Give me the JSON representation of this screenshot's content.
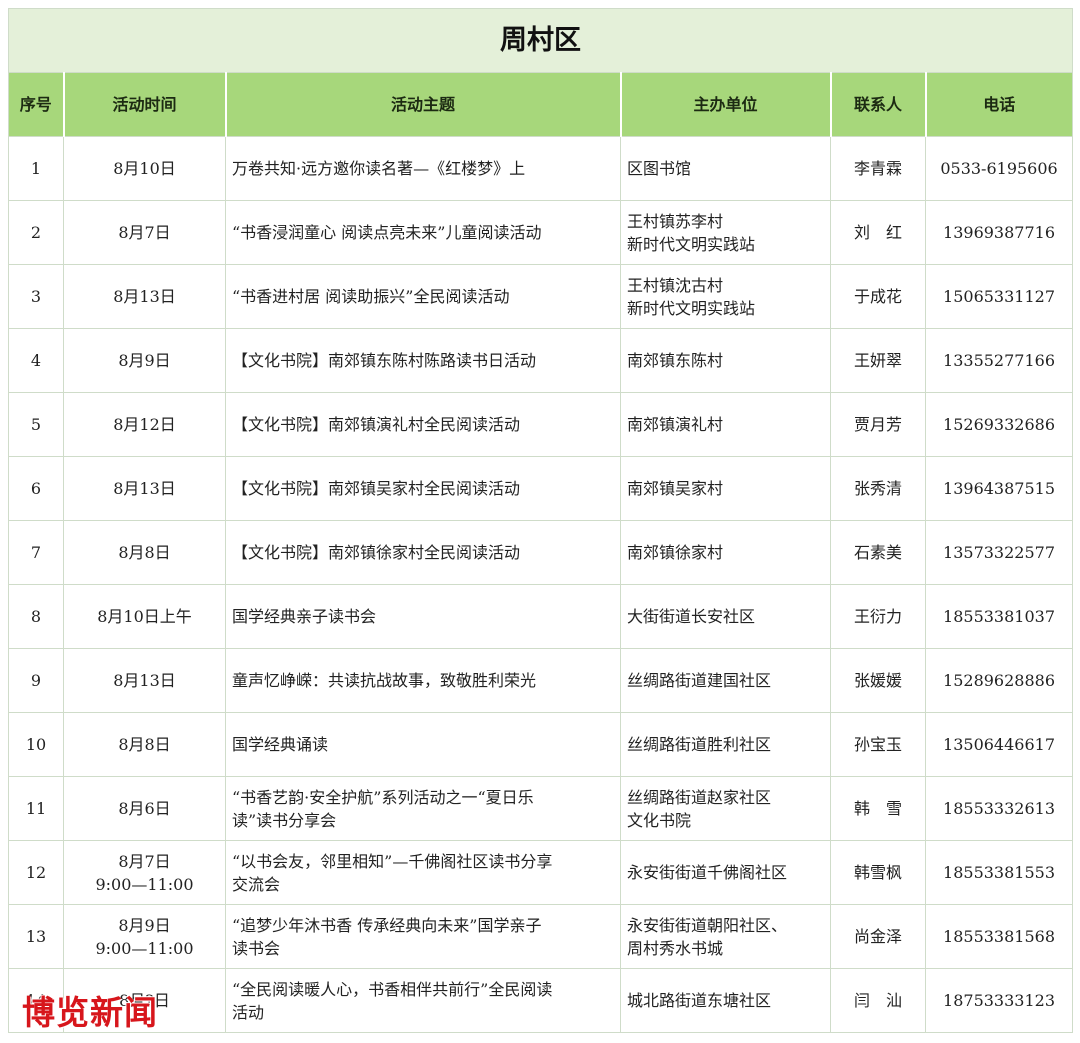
{
  "title": "周村区",
  "columns": {
    "no": "序号",
    "date": "活动时间",
    "topic": "活动主题",
    "host": "主办单位",
    "contact": "联系人",
    "phone": "电话"
  },
  "rows": [
    {
      "no": "1",
      "date": "8月10日",
      "topic": "万卷共知·远方邀你读名著—《红楼梦》上",
      "host": "区图书馆",
      "contact": "李青霖",
      "phone": "0533-6195606"
    },
    {
      "no": "2",
      "date": "8月7日",
      "topic": "“书香浸润童心 阅读点亮未来”儿童阅读活动",
      "host": "王村镇苏李村\n新时代文明实践站",
      "contact": "刘　红",
      "phone": "13969387716"
    },
    {
      "no": "3",
      "date": "8月13日",
      "topic": "“书香进村居 阅读助振兴”全民阅读活动",
      "host": "王村镇沈古村\n新时代文明实践站",
      "contact": "于成花",
      "phone": "15065331127"
    },
    {
      "no": "4",
      "date": "8月9日",
      "topic": "【文化书院】南郊镇东陈村陈路读书日活动",
      "host": "南郊镇东陈村",
      "contact": "王妍翠",
      "phone": "13355277166"
    },
    {
      "no": "5",
      "date": "8月12日",
      "topic": "【文化书院】南郊镇演礼村全民阅读活动",
      "host": "南郊镇演礼村",
      "contact": "贾月芳",
      "phone": "15269332686"
    },
    {
      "no": "6",
      "date": "8月13日",
      "topic": "【文化书院】南郊镇吴家村全民阅读活动",
      "host": "南郊镇吴家村",
      "contact": "张秀清",
      "phone": "13964387515"
    },
    {
      "no": "7",
      "date": "8月8日",
      "topic": "【文化书院】南郊镇徐家村全民阅读活动",
      "host": "南郊镇徐家村",
      "contact": "石素美",
      "phone": "13573322577"
    },
    {
      "no": "8",
      "date": "8月10日上午",
      "topic": "国学经典亲子读书会",
      "host": "大街街道长安社区",
      "contact": "王衍力",
      "phone": "18553381037"
    },
    {
      "no": "9",
      "date": "8月13日",
      "topic": "童声忆峥嵘：共读抗战故事，致敬胜利荣光",
      "host": "丝绸路街道建国社区",
      "contact": "张媛媛",
      "phone": "15289628886"
    },
    {
      "no": "10",
      "date": "8月8日",
      "topic": "国学经典诵读",
      "host": "丝绸路街道胜利社区",
      "contact": "孙宝玉",
      "phone": "13506446617"
    },
    {
      "no": "11",
      "date": "8月6日",
      "topic": "“书香艺韵·安全护航”系列活动之一“夏日乐\n读”读书分享会",
      "host": "丝绸路街道赵家社区\n文化书院",
      "contact": "韩　雪",
      "phone": "18553332613"
    },
    {
      "no": "12",
      "date": "8月7日\n9:00—11:00",
      "topic": "“以书会友，邻里相知”—千佛阁社区读书分享\n交流会",
      "host": "永安街街道千佛阁社区",
      "contact": "韩雪枫",
      "phone": "18553381553"
    },
    {
      "no": "13",
      "date": "8月9日\n9:00—11:00",
      "topic": "“追梦少年沐书香 传承经典向未来”国学亲子\n读书会",
      "host": "永安街街道朝阳社区、\n周村秀水书城",
      "contact": "尚金泽",
      "phone": "18553381568"
    },
    {
      "no": "14",
      "date": "8月?日",
      "topic": "“全民阅读暖人心，书香相伴共前行”全民阅读\n活动",
      "host": "城北路街道东塘社区",
      "contact": "闫　汕",
      "phone": "18753333123"
    }
  ],
  "watermark": "博览新闻",
  "colors": {
    "title_bg": "#e4f0d9",
    "header_bg": "#a7d77b",
    "grid_line": "#cfdcc9",
    "watermark": "#d7161c"
  }
}
